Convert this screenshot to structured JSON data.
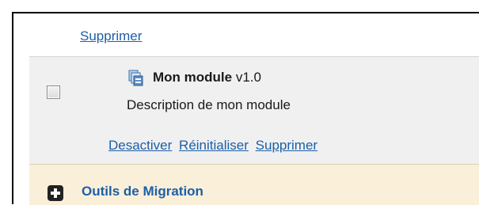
{
  "top_row": {
    "delete_link": "Supprimer"
  },
  "module": {
    "icon": "module-package-icon",
    "name": "Mon module",
    "version": "v1.0",
    "description": "Description de mon module",
    "actions": {
      "deactivate": "Desactiver",
      "reset": "Réinitialiser",
      "delete": "Supprimer"
    }
  },
  "section": {
    "icon": "plus-icon",
    "title": "Outils de Migration"
  },
  "colors": {
    "link": "#1c5fa8",
    "module_bg": "#f0f0f0",
    "section_bg": "#faefd9"
  }
}
